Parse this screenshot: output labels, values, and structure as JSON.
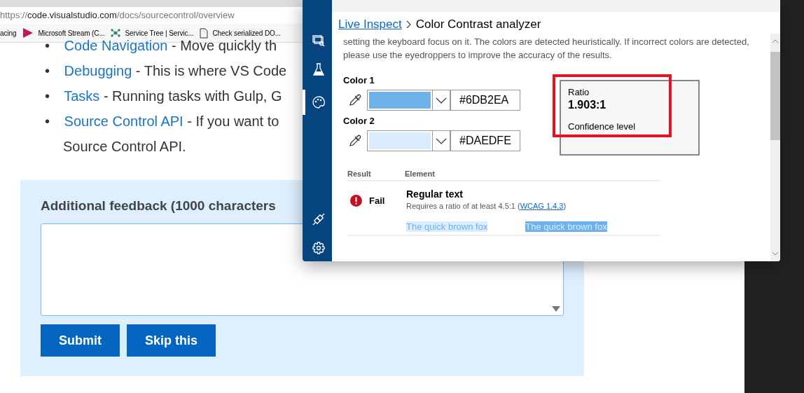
{
  "browser": {
    "address": {
      "scheme": "https://",
      "host": "code.visualstudio.com",
      "path": "/docs/sourcecontrol/overview"
    },
    "bookmarks": [
      {
        "label": "acing"
      },
      {
        "label": "Microsoft Stream (C..."
      },
      {
        "label": "Service Tree | Servic..."
      },
      {
        "label": "Check serialized DO..."
      }
    ]
  },
  "page": {
    "list": [
      {
        "bullet": "•",
        "link": "Code Navigation",
        "text": " - Move quickly th"
      },
      {
        "bullet": "•",
        "link": "Debugging",
        "text": " - This is where VS Code"
      },
      {
        "bullet": "•",
        "link": "Tasks",
        "text": " - Running tasks with Gulp, G"
      },
      {
        "bullet": "•",
        "link": "Source Control API",
        "text": " - If you want to",
        "continuation": "Source Control API."
      }
    ],
    "feedback": {
      "label": "Additional feedback (1000 characters",
      "buttons": [
        "Submit",
        "Skip this"
      ]
    }
  },
  "panel": {
    "nav": [
      {
        "selected": false
      },
      {
        "selected": false
      },
      {
        "selected": true
      },
      {
        "selected": false
      },
      {
        "selected": false
      }
    ],
    "breadcrumb": {
      "link": "Live Inspect",
      "current": "Color Contrast analyzer"
    },
    "description": "setting the keyboard focus on it. The colors are detected heuristically. If incorrect colors are detected, please use the eyedroppers to improve the accuracy of the results.",
    "colors": [
      {
        "label": "Color 1",
        "color": "#6db2ea",
        "value": "#6DB2EA"
      },
      {
        "label": "Color 2",
        "color": "#daedfe",
        "value": "#DAEDFE"
      }
    ],
    "ratio": {
      "label": "Ratio",
      "value": "1.903:1",
      "confidence": "Confidence level"
    },
    "results": {
      "columns": [
        "Result",
        "Element"
      ],
      "rows": [
        {
          "result": "Fail",
          "element": "Regular text",
          "requirement": "Requires a ratio of at least 4.5:1 (",
          "link": "WCAG 1.4.3",
          "close": ")",
          "samples": [
            "The quick brown fox",
            "The quick brown fox"
          ]
        }
      ]
    }
  }
}
